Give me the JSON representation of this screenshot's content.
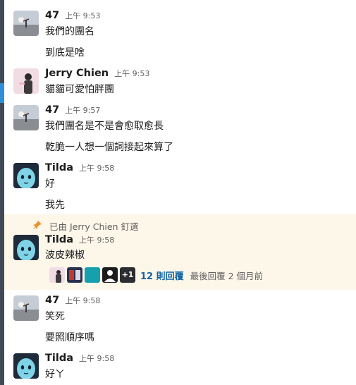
{
  "messages": [
    {
      "author": "47",
      "time": "上午 9:53",
      "lines": [
        "我們的團名",
        "到底是啥"
      ]
    },
    {
      "author": "Jerry Chien",
      "time": "上午 9:53",
      "lines": [
        "貓貓可愛怕胖團"
      ]
    },
    {
      "author": "47",
      "time": "上午 9:57",
      "lines": [
        "我們團名是不是會愈取愈長",
        "乾脆一人想一個詞接起來算了"
      ]
    },
    {
      "author": "Tilda",
      "time": "上午 9:58",
      "lines": [
        "好",
        "我先"
      ]
    },
    {
      "author": "Tilda",
      "time": "上午 9:58",
      "lines": [
        "波皮辣椒"
      ]
    },
    {
      "author": "47",
      "time": "上午 9:58",
      "lines": [
        "笑死",
        "要照順序嗎"
      ]
    },
    {
      "author": "Tilda",
      "time": "上午 9:58",
      "lines": [
        "好ㄚ"
      ]
    }
  ],
  "pinned": {
    "label": "已由 Jerry Chien 釘選"
  },
  "thread": {
    "extra_count": "+1",
    "replies": "12 則回覆",
    "last_reply": "最後回覆 2 個月前"
  },
  "colors": {
    "sidebar": "#3f4a56",
    "pinned_bg": "#fdf7ea",
    "link": "#1264a3"
  },
  "icons": [
    "pin-icon",
    "avatar-47",
    "avatar-jerry",
    "avatar-tilda"
  ]
}
